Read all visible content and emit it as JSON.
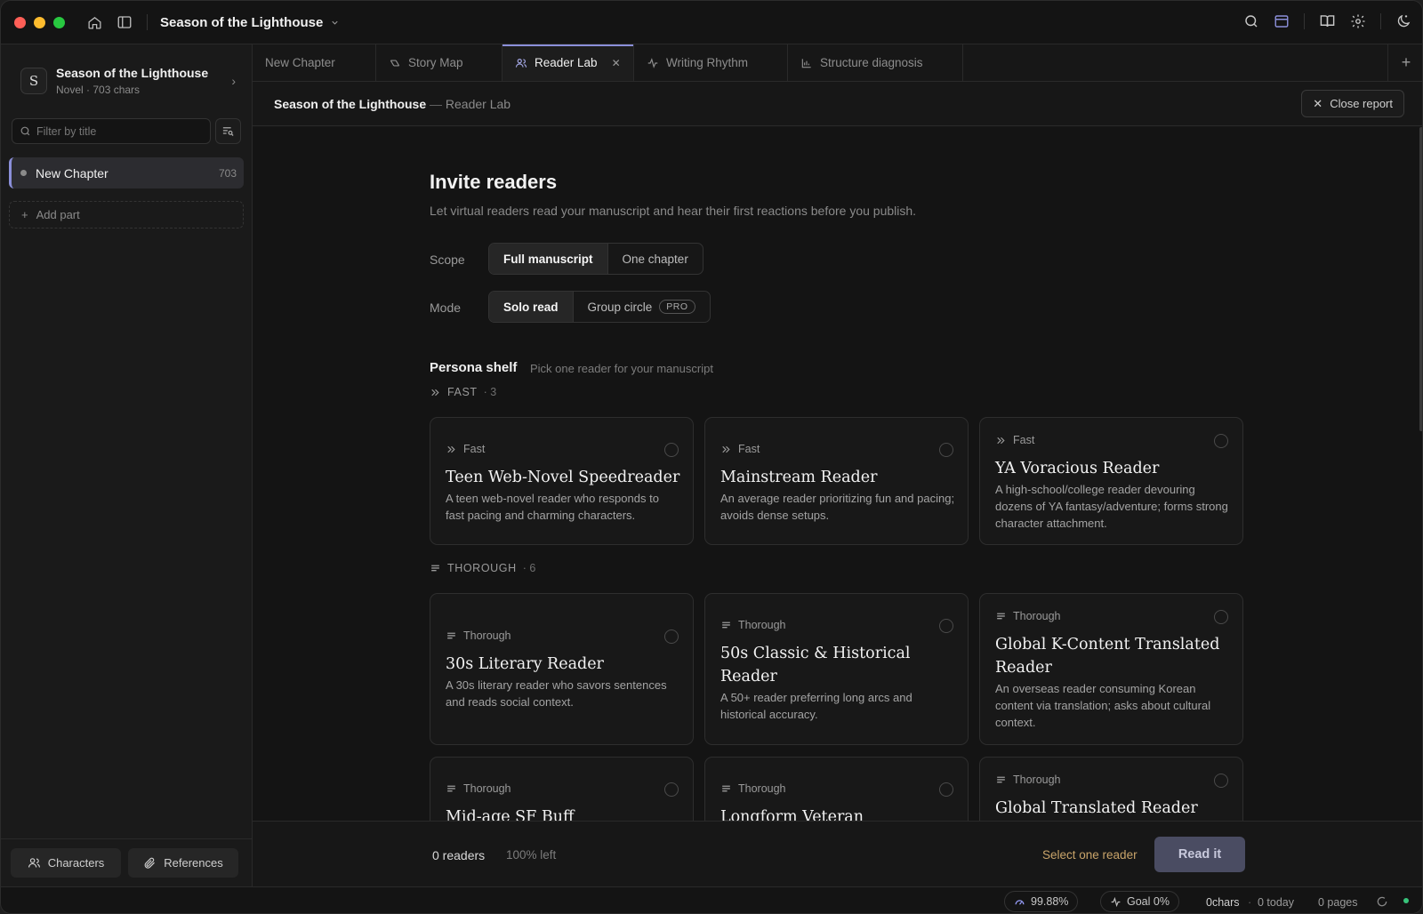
{
  "app": {
    "title": "Season of the Lighthouse"
  },
  "sidebar": {
    "project_initial": "S",
    "project_name": "Season of the Lighthouse",
    "project_meta": "Novel · 703 chars",
    "filter_placeholder": "Filter by title",
    "chapters": [
      {
        "label": "New Chapter",
        "count": "703"
      }
    ],
    "add_part": "Add part",
    "characters_button": "Characters",
    "references_button": "References"
  },
  "tabs": [
    {
      "label": "New Chapter",
      "icon": "none"
    },
    {
      "label": "Story Map",
      "icon": "map-icon"
    },
    {
      "label": "Reader Lab",
      "icon": "users-icon",
      "active": true
    },
    {
      "label": "Writing Rhythm",
      "icon": "pulse-icon"
    },
    {
      "label": "Structure diagnosis",
      "icon": "bar-chart-icon"
    }
  ],
  "header": {
    "breadcrumb_main": "Season of the Lighthouse",
    "breadcrumb_sep": " — ",
    "breadcrumb_sub": "Reader Lab",
    "close_report": "Close report"
  },
  "invite": {
    "title": "Invite readers",
    "subtitle": "Let virtual readers read your manuscript and hear their first reactions before you publish.",
    "scope_label": "Scope",
    "scope_options": [
      "Full manuscript",
      "One chapter"
    ],
    "mode_label": "Mode",
    "mode_options": [
      "Solo read",
      "Group circle"
    ],
    "pro_badge": "PRO"
  },
  "shelf": {
    "title": "Persona shelf",
    "subtitle": "Pick one reader for your manuscript",
    "groups": [
      {
        "label": "FAST",
        "count": "· 3",
        "cards": [
          {
            "tag": "Fast",
            "title": "Teen Web-Novel Speedreader",
            "desc": "A teen web-novel reader who responds to fast pacing and charming characters."
          },
          {
            "tag": "Fast",
            "title": "Mainstream Reader",
            "desc": "An average reader prioritizing fun and pacing; avoids dense setups."
          },
          {
            "tag": "Fast",
            "title": "YA Voracious Reader",
            "desc": "A high-school/college reader devouring dozens of YA fantasy/adventure; forms strong character attachment."
          }
        ]
      },
      {
        "label": "THOROUGH",
        "count": "· 6",
        "cards": [
          {
            "tag": "Thorough",
            "title": "30s Literary Reader",
            "desc": "A 30s literary reader who savors sentences and reads social context."
          },
          {
            "tag": "Thorough",
            "title": "50s Classic & Historical Reader",
            "desc": "A 50+ reader preferring long arcs and historical accuracy."
          },
          {
            "tag": "Thorough",
            "title": "Global K-Content Translated Reader",
            "desc": "An overseas reader consuming Korean content via translation; asks about cultural context."
          },
          {
            "tag": "Thorough",
            "title": "Mid-age SF Buff",
            "desc": ""
          },
          {
            "tag": "Thorough",
            "title": "Longform Veteran",
            "desc": ""
          },
          {
            "tag": "Thorough",
            "title": "Global Translated Reader",
            "desc": ""
          }
        ]
      }
    ]
  },
  "footer": {
    "readers": "0 readers",
    "left": "100% left",
    "hint": "Select one reader",
    "read_button": "Read it"
  },
  "status": {
    "score": "99.88%",
    "goal": "Goal 0%",
    "chars": "0chars",
    "sep": "·",
    "today": "0 today",
    "pages": "0 pages"
  },
  "colors": {
    "accent": "#8b8fd9",
    "hint": "#c9a46a",
    "online": "#37c37a"
  }
}
